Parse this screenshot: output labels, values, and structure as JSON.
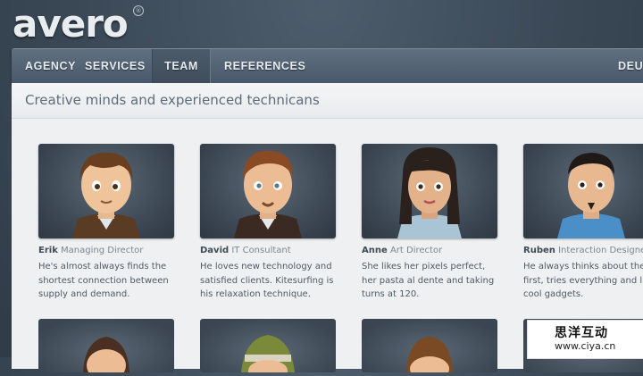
{
  "brand": {
    "logo": "avero",
    "reg": "®"
  },
  "nav": {
    "items": [
      "AGENCY",
      "SERVICES",
      "TEAM",
      "REFERENCES"
    ],
    "active": "TEAM",
    "lang": "DEUT"
  },
  "page": {
    "subtitle": "Creative minds and experienced technicans"
  },
  "team": [
    {
      "name": "Erik",
      "role": "Managing Director",
      "desc": "He's almost always finds the shortest connection between supply and demand."
    },
    {
      "name": "David",
      "role": "IT Consultant",
      "desc": "He loves new technology and satisfied clients. Kitesurfing is his relaxation technique."
    },
    {
      "name": "Anne",
      "role": "Art Director",
      "desc": "She likes her pixels perfect, her pasta al dente and taking turns at 120."
    },
    {
      "name": "Ruben",
      "role": "Interaction Designer",
      "desc": "He always thinks about the u first, tries everything and like cool gadgets."
    }
  ],
  "watermark": {
    "cn": "思洋互动",
    "url": "www.ciya.cn"
  }
}
